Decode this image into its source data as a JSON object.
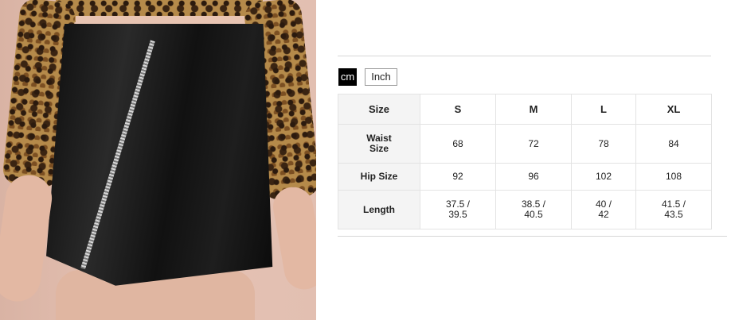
{
  "units": {
    "active": "cm",
    "inactive": "Inch"
  },
  "size_table": {
    "corner": "Size",
    "columns": [
      "S",
      "M",
      "L",
      "XL"
    ],
    "rows": [
      {
        "label": "Waist Size",
        "values": [
          "68",
          "72",
          "78",
          "84"
        ]
      },
      {
        "label": "Hip Size",
        "values": [
          "92",
          "96",
          "102",
          "108"
        ]
      },
      {
        "label": "Length",
        "values": [
          "37.5 / 39.5",
          "38.5 / 40.5",
          "40 / 42",
          "41.5 / 43.5"
        ]
      }
    ]
  }
}
